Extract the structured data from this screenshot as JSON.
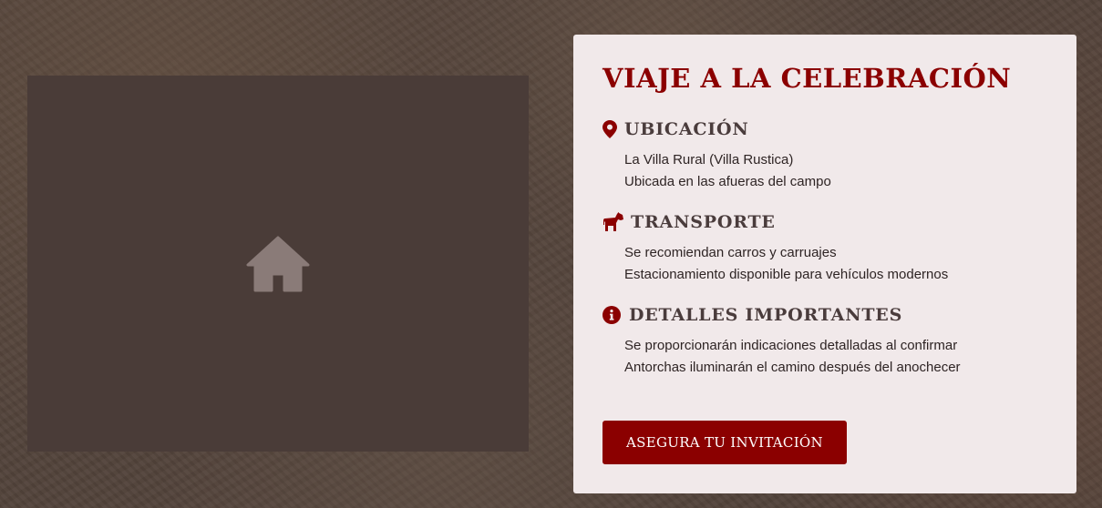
{
  "colors": {
    "accent": "#8b0000",
    "card_background": "#f1e9ea",
    "placeholder_background": "#4a3c38",
    "heading_text": "#4a3c3c"
  },
  "image_placeholder": {
    "icon": "home-icon"
  },
  "card": {
    "title": "VIAJE A LA CELEBRACIÓN",
    "sections": [
      {
        "icon": "map-marker-icon",
        "title": "UBICACIÓN",
        "lines": [
          "La Villa Rural (Villa Rustica)",
          "Ubicada en las afueras del campo"
        ]
      },
      {
        "icon": "horse-icon",
        "title": "TRANSPORTE",
        "lines": [
          "Se recomiendan carros y carruajes",
          "Estacionamiento disponible para vehículos modernos"
        ]
      },
      {
        "icon": "info-circle-icon",
        "title": "DETALLES IMPORTANTES",
        "lines": [
          "Se proporcionarán indicaciones detalladas al confirmar",
          "Antorchas iluminarán el camino después del anochecer"
        ]
      }
    ],
    "cta_label": "ASEGURA TU INVITACIÓN"
  }
}
